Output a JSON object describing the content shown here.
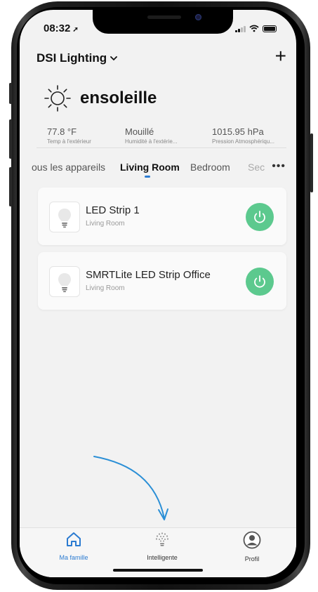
{
  "status_bar": {
    "time": "08:32"
  },
  "header": {
    "home_name": "DSI Lighting",
    "add_label": "+"
  },
  "weather": {
    "condition": "ensoleille",
    "stats": [
      {
        "value": "77.8 °F",
        "label": "Temp à l'extérieur"
      },
      {
        "value": "Mouillé",
        "label": "Humidité à l'extérie..."
      },
      {
        "value": "1015.95 hPa",
        "label": "Pression Atmosphériqu..."
      }
    ]
  },
  "tabs": [
    {
      "label": "ous les appareils"
    },
    {
      "label": "Living Room",
      "active": true
    },
    {
      "label": "Bedroom"
    },
    {
      "label": "Sec"
    }
  ],
  "more_label": "•••",
  "devices": [
    {
      "name": "LED Strip 1",
      "room": "Living Room",
      "on": true
    },
    {
      "name": "SMRTLite LED Strip Office",
      "room": "Living Room",
      "on": true
    }
  ],
  "bottom_nav": [
    {
      "label": "Ma famille",
      "icon": "home-icon",
      "active": true
    },
    {
      "label": "Intelligente",
      "icon": "smart-scene-icon"
    },
    {
      "label": "Profil",
      "icon": "profile-icon"
    }
  ],
  "colors": {
    "accent": "#2b7bd1",
    "power_on": "#5cc98e",
    "annotation_arrow": "#2b8fd6"
  }
}
